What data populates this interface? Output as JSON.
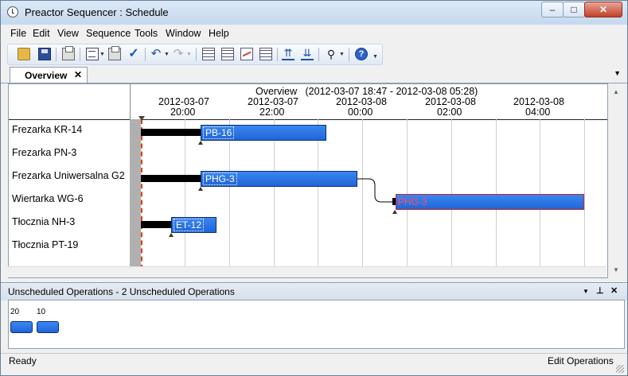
{
  "window": {
    "title": "Preactor Sequencer : Schedule"
  },
  "menu": [
    "File",
    "Edit",
    "View",
    "Sequence",
    "Tools",
    "Window",
    "Help"
  ],
  "tab": {
    "label": "Overview",
    "close": "✕"
  },
  "schedule": {
    "overview_label": "Overview",
    "range": "(2012-03-07 18:47 - 2012-03-08 05:28)",
    "ticks": [
      {
        "date": "2012-03-07",
        "time": "20:00"
      },
      {
        "date": "2012-03-07",
        "time": "22:00"
      },
      {
        "date": "2012-03-08",
        "time": "00:00"
      },
      {
        "date": "2012-03-08",
        "time": "02:00"
      },
      {
        "date": "2012-03-08",
        "time": "04:00"
      }
    ],
    "resources": [
      "Frezarka KR-14",
      "Frezarka PN-3",
      "Frezarka Uniwersalna G2",
      "Wiertarka WG-6",
      "Tłocznia NH-3",
      "Tłocznia PT-19"
    ],
    "operations": [
      "PB-16",
      "PHG-3",
      "PHG-3",
      "ET-12"
    ]
  },
  "unscheduled": {
    "title": "Unscheduled Operations - 2 Unscheduled Operations",
    "items": [
      "20",
      "10"
    ]
  },
  "status": {
    "left": "Ready",
    "right": "Edit Operations"
  },
  "colors": {
    "operation": "#2f77e6",
    "selected_border": "#cc2030",
    "now_line": "#e04010"
  }
}
